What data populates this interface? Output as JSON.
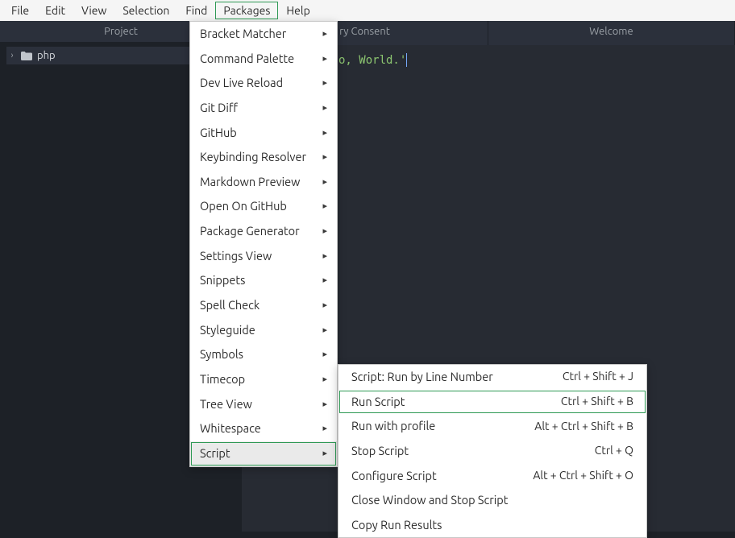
{
  "menubar": [
    "File",
    "Edit",
    "View",
    "Selection",
    "Find",
    "Packages",
    "Help"
  ],
  "menubar_highlight_index": 5,
  "sidebar": {
    "title": "Project",
    "root": "php"
  },
  "tabs": [
    "ry Consent",
    "Welcome"
  ],
  "code_visible": "o, World.'",
  "packages_menu": [
    {
      "label": "Bracket Matcher",
      "sub": true
    },
    {
      "label": "Command Palette",
      "sub": true
    },
    {
      "label": "Dev Live Reload",
      "sub": true
    },
    {
      "label": "Git Diff",
      "sub": true
    },
    {
      "label": "GitHub",
      "sub": true
    },
    {
      "label": "Keybinding Resolver",
      "sub": true
    },
    {
      "label": "Markdown Preview",
      "sub": true
    },
    {
      "label": "Open On GitHub",
      "sub": true
    },
    {
      "label": "Package Generator",
      "sub": true
    },
    {
      "label": "Settings View",
      "sub": true
    },
    {
      "label": "Snippets",
      "sub": true
    },
    {
      "label": "Spell Check",
      "sub": true
    },
    {
      "label": "Styleguide",
      "sub": true
    },
    {
      "label": "Symbols",
      "sub": true
    },
    {
      "label": "Timecop",
      "sub": true
    },
    {
      "label": "Tree View",
      "sub": true
    },
    {
      "label": "Whitespace",
      "sub": true
    },
    {
      "label": "Script",
      "sub": true,
      "hovered": true,
      "highlighted": true
    }
  ],
  "script_submenu": [
    {
      "label": "Script: Run by Line Number",
      "shortcut": "Ctrl + Shift + J"
    },
    {
      "label": "Run Script",
      "shortcut": "Ctrl + Shift + B",
      "highlighted": true
    },
    {
      "label": "Run with profile",
      "shortcut": "Alt + Ctrl + Shift + B"
    },
    {
      "label": "Stop Script",
      "shortcut": "Ctrl + Q"
    },
    {
      "label": "Configure Script",
      "shortcut": "Alt + Ctrl + Shift + O"
    },
    {
      "label": "Close Window and Stop Script",
      "shortcut": ""
    },
    {
      "label": "Copy Run Results",
      "shortcut": ""
    }
  ]
}
